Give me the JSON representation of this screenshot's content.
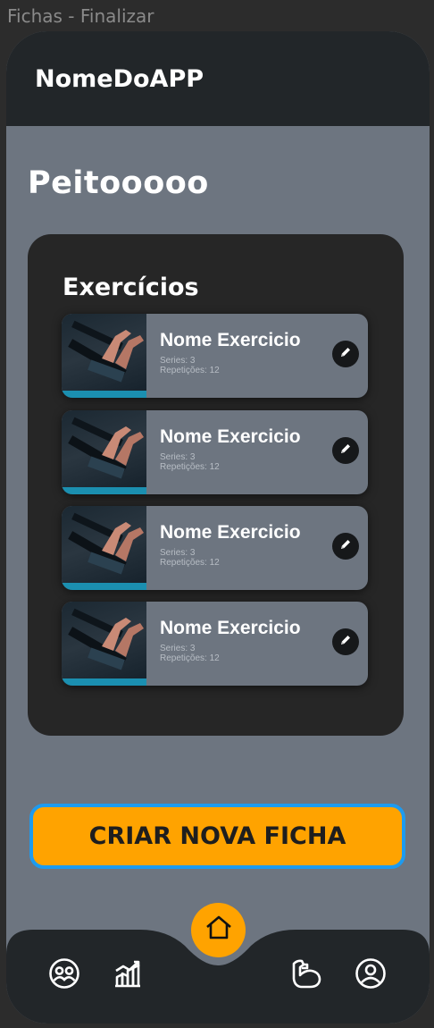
{
  "window": {
    "title": "Fichas - Finalizar"
  },
  "header": {
    "app_name": "NomeDoAPP"
  },
  "page": {
    "heading": "Peitooooo"
  },
  "panel": {
    "title": "Exercícios",
    "exercises": [
      {
        "name": "Nome Exercicio",
        "series": "Series: 3",
        "reps": "Repetições: 12"
      },
      {
        "name": "Nome Exercicio",
        "series": "Series: 3",
        "reps": "Repetições: 12"
      },
      {
        "name": "Nome Exercicio",
        "series": "Series: 3",
        "reps": "Repetições: 12"
      },
      {
        "name": "Nome Exercicio",
        "series": "Series: 3",
        "reps": "Repetições: 12"
      }
    ]
  },
  "actions": {
    "create_label": "CRIAR NOVA FICHA"
  },
  "nav": {
    "items": [
      {
        "icon": "users-icon"
      },
      {
        "icon": "chart-icon"
      },
      {
        "icon": "home-icon"
      },
      {
        "icon": "arm-muscle-icon"
      },
      {
        "icon": "profile-icon"
      }
    ]
  },
  "colors": {
    "accent": "#ffa300",
    "focus_border": "#1d9bf0",
    "header_bg": "#222629",
    "panel_bg": "#262626",
    "screen_bg": "#6d7580"
  }
}
